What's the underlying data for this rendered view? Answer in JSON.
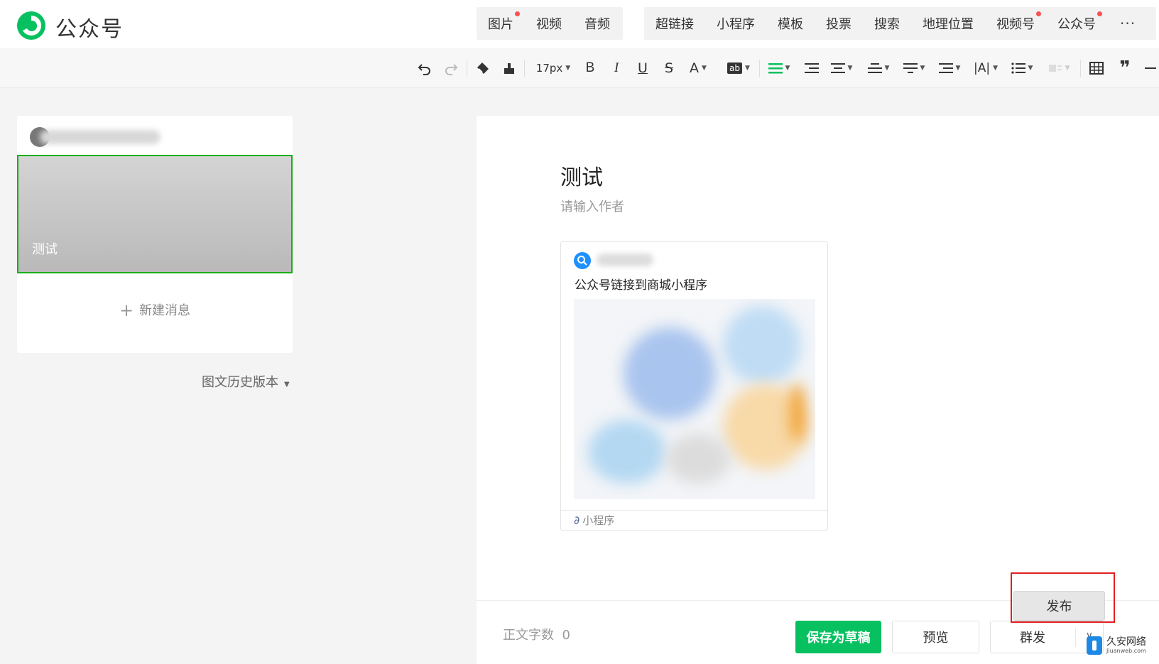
{
  "header": {
    "brand": "公众号",
    "insert_group1": [
      {
        "label": "图片",
        "dot": true
      },
      {
        "label": "视频",
        "dot": false
      },
      {
        "label": "音频",
        "dot": false
      }
    ],
    "insert_group2": [
      {
        "label": "超链接",
        "dot": false
      },
      {
        "label": "小程序",
        "dot": false
      },
      {
        "label": "模板",
        "dot": false
      },
      {
        "label": "投票",
        "dot": false
      },
      {
        "label": "搜索",
        "dot": false
      },
      {
        "label": "地理位置",
        "dot": false
      },
      {
        "label": "视频号",
        "dot": true
      },
      {
        "label": "公众号",
        "dot": true
      }
    ],
    "more": "···"
  },
  "toolbar": {
    "font_size": "17px"
  },
  "sidebar": {
    "article_title": "测试",
    "new_message": "新建消息",
    "history": "图文历史版本"
  },
  "editor": {
    "title": "测试",
    "author_placeholder": "请输入作者",
    "miniprogram_card": {
      "title": "公众号链接到商城小程序",
      "footer": "小程序"
    },
    "word_count_label": "正文字数",
    "word_count_value": "0"
  },
  "actions": {
    "save_draft": "保存为草稿",
    "preview": "预览",
    "mass_send": "群发",
    "publish": "发布"
  },
  "watermark": {
    "name": "久安网络",
    "url": "Jiuanweb.com"
  },
  "colors": {
    "accent_green": "#07c160",
    "selection_green": "#1aad19",
    "highlight_red": "#e02020",
    "dot_red": "#fa5151"
  }
}
